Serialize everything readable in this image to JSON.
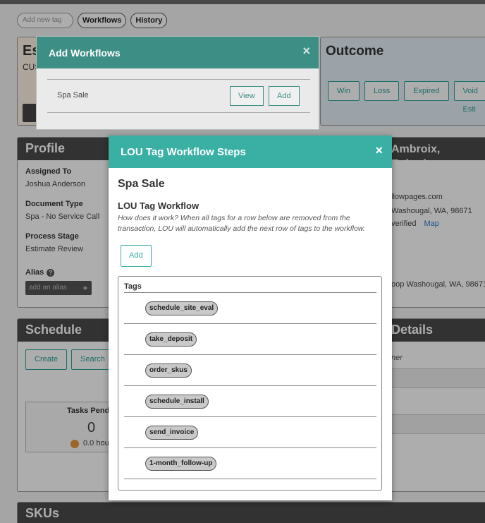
{
  "tagbar": {
    "add_tag_placeholder": "Add new tag",
    "workflows_label": "Workflows",
    "history_label": "History"
  },
  "estimate_card": {
    "title_fragment": "Es",
    "subtitle_fragment": "CUS"
  },
  "outcome": {
    "title": "Outcome",
    "buttons": [
      "Win",
      "Loss",
      "Expired",
      "Void Esti"
    ]
  },
  "profile": {
    "title": "Profile",
    "assigned_to_label": "Assigned To",
    "assigned_to_value": "Joshua Anderson",
    "doc_type_label": "Document Type",
    "doc_type_value": "Spa - No Service Call",
    "process_stage_label": "Process Stage",
    "process_stage_value": "Estimate Review",
    "alias_label": "Alias",
    "alias_placeholder": "add an alias",
    "alias_add": "+"
  },
  "customer": {
    "name_fragment": "Ambroix, Ephrain",
    "email_fragment": "llowpages.com",
    "address_fragment": "Washougal, WA, 98671",
    "verified_fragment": "verified",
    "map_link": "Map",
    "address2_fragment": "oop Washougal, WA, 98671"
  },
  "schedule": {
    "title": "Schedule",
    "create_label": "Create",
    "search_label": "Search",
    "tasks_label": "Tasks Pendi",
    "tasks_count": "0",
    "hours_fragment": "0.0 hou"
  },
  "details": {
    "title_fragment": "Details",
    "owner_fragment": "ner"
  },
  "skus": {
    "title": "SKUs"
  },
  "add_workflows": {
    "title": "Add Workflows",
    "close": "×",
    "row_name": "Spa Sale",
    "view_label": "View",
    "add_label": "Add"
  },
  "modal": {
    "title": "LOU Tag Workflow Steps",
    "close": "×",
    "heading": "Spa Sale",
    "subheading": "LOU Tag Workflow",
    "help_text": "How does it work? When all tags for a row below are removed from the transaction, LOU will automatically add the next row of tags to the workflow.",
    "add_label": "Add",
    "tags_header": "Tags",
    "tags": [
      "schedule_site_eval",
      "take_deposit",
      "order_skus",
      "schedule_install",
      "send_invoice",
      "1-month_follow-up"
    ]
  }
}
